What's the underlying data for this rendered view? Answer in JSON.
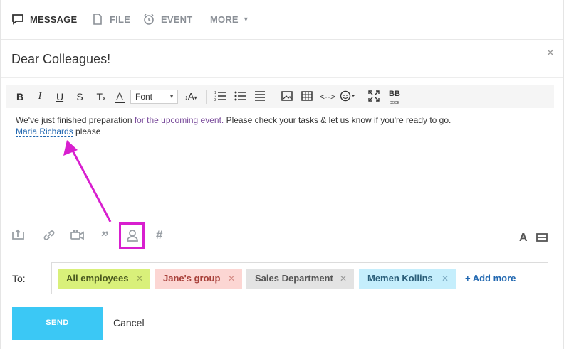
{
  "tabs": {
    "message": "MESSAGE",
    "file": "FILE",
    "event": "EVENT",
    "more": "MORE"
  },
  "subject": "Dear Colleagues!",
  "toolbar": {
    "font_label": "Font",
    "icons": [
      "bold-icon",
      "italic-icon",
      "underline-icon",
      "strikethrough-icon",
      "clear-format-icon",
      "font-color-icon",
      "font-select",
      "font-size-icon",
      "numbered-list-icon",
      "bullet-list-icon",
      "align-icon",
      "image-icon",
      "table-icon",
      "source-code-icon",
      "smiley-icon",
      "fullscreen-icon",
      "bbcode-icon"
    ]
  },
  "body": {
    "text_before": "We've just finished preparation ",
    "link_text": "for the upcoming event.",
    "text_after": " Please check your tasks & let us know if you're ready to go.",
    "mention": "Maria Richards",
    "text_end": " please"
  },
  "bottom_tools": [
    "upload-icon",
    "link-icon",
    "video-icon",
    "quote-icon",
    "mention-user-icon",
    "hashtag-icon",
    "text-format-icon",
    "panel-toggle-icon"
  ],
  "recipients": {
    "label": "To:",
    "chips": [
      {
        "label": "All employees",
        "bg": "#d9f07a",
        "color": "#4b5a1f",
        "x_color": "#9aaa55"
      },
      {
        "label": "Jane's group",
        "bg": "#fcd6d3",
        "color": "#a8403a",
        "x_color": "#d48a84"
      },
      {
        "label": "Sales Department",
        "bg": "#e3e3e3",
        "color": "#555555",
        "x_color": "#999999"
      },
      {
        "label": "Memen Kollins",
        "bg": "#c5eefc",
        "color": "#2b5f7a",
        "x_color": "#7aa9c1"
      }
    ],
    "add_more": "+ Add more"
  },
  "buttons": {
    "send": "SEND",
    "cancel": "Cancel"
  },
  "colors": {
    "accent": "#3bc8f5",
    "annotation": "#d81fcf",
    "mention": "#2067b0",
    "link": "#7b4d9c"
  }
}
